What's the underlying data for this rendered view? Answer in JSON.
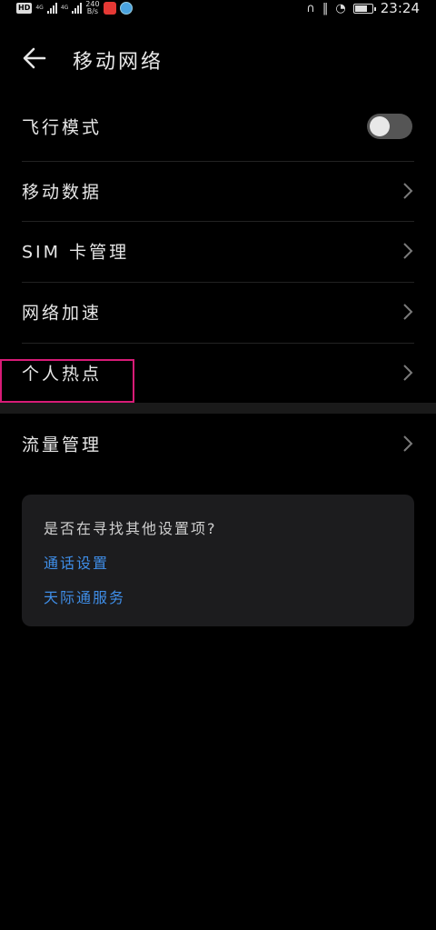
{
  "status_bar": {
    "hd_badge": "HD",
    "hd_sub": "2",
    "net1": "4G",
    "net2": "4G",
    "speed_value": "240",
    "speed_unit": "B/s",
    "time": "23:24"
  },
  "header": {
    "title": "移动网络"
  },
  "settings": [
    {
      "label": "飞行模式",
      "type": "toggle",
      "on": false
    },
    {
      "label": "移动数据",
      "type": "link"
    },
    {
      "label": "SIM 卡管理",
      "type": "link"
    },
    {
      "label": "网络加速",
      "type": "link"
    },
    {
      "label": "个人热点",
      "type": "link",
      "highlighted": true
    },
    {
      "label": "流量管理",
      "type": "link"
    }
  ],
  "suggestions": {
    "question": "是否在寻找其他设置项?",
    "links": [
      "通话设置",
      "天际通服务"
    ]
  },
  "colors": {
    "background": "#000000",
    "link": "#3f8ee8",
    "highlight_border": "#d81b77"
  }
}
